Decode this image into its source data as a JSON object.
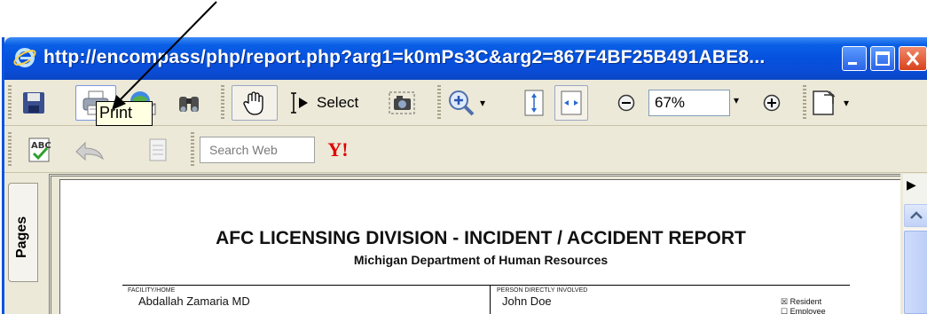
{
  "window": {
    "title": "http://encompass/php/report.php?arg1=k0mPs3C&arg2=867F4BF25B491ABE8..."
  },
  "toolbar": {
    "select_label": "Select",
    "zoom_value": "67%",
    "search_placeholder": "Search Web",
    "yahoo_label": "Y!",
    "print_tooltip": "Print"
  },
  "sidebar": {
    "pages_tab": "Pages"
  },
  "document": {
    "title": "AFC LICENSING DIVISION - INCIDENT / ACCIDENT REPORT",
    "subtitle": "Michigan Department of Human Resources",
    "facility_label": "FACILITY/HOME",
    "facility_value": "Abdallah Zamaria MD",
    "person_label": "PERSON DIRECTLY INVOLVED",
    "person_value": "John Doe",
    "checkbox_resident": "Resident",
    "checkbox_employee": "Employee"
  },
  "colors": {
    "titlebar": "#0551de",
    "toolbar_bg": "#ece9d8",
    "tooltip_bg": "#ffffe1"
  }
}
